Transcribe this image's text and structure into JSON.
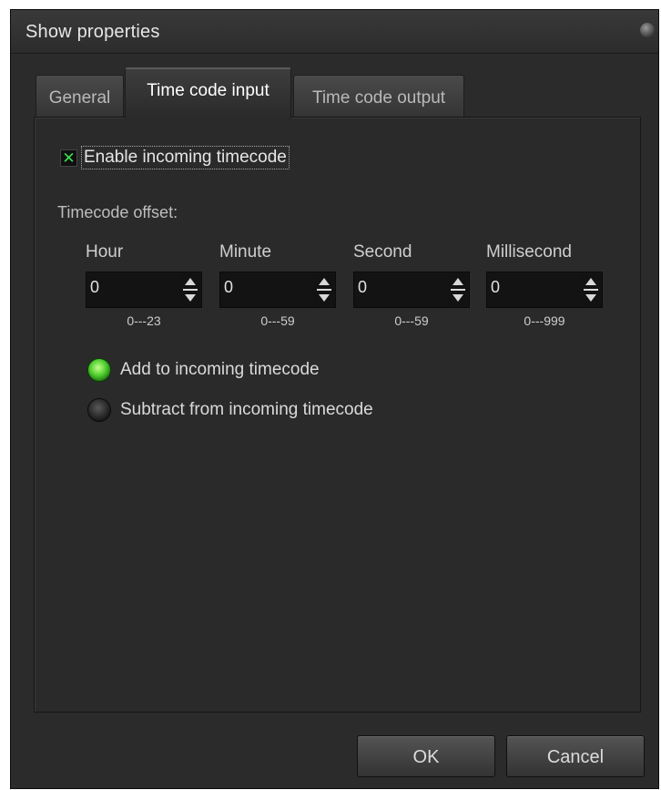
{
  "window": {
    "title": "Show properties"
  },
  "tabs": [
    {
      "label": "General",
      "active": false
    },
    {
      "label": "Time code input",
      "active": true
    },
    {
      "label": "Time code output",
      "active": false
    }
  ],
  "enable_incoming": {
    "label": "Enable incoming timecode",
    "checked": true
  },
  "offset": {
    "label": "Timecode offset:",
    "fields": [
      {
        "label": "Hour",
        "value": "0",
        "range": "0---23"
      },
      {
        "label": "Minute",
        "value": "0",
        "range": "0---59"
      },
      {
        "label": "Second",
        "value": "0",
        "range": "0---59"
      },
      {
        "label": "Millisecond",
        "value": "0",
        "range": "0---999"
      }
    ]
  },
  "mode": {
    "options": [
      {
        "label": "Add to incoming timecode",
        "selected": true
      },
      {
        "label": "Subtract from incoming timecode",
        "selected": false
      }
    ]
  },
  "buttons": {
    "ok": "OK",
    "cancel": "Cancel"
  },
  "colors": {
    "background": "#2b2b2b",
    "accent_green": "#4dcd2e",
    "text": "#e6e6e6"
  }
}
